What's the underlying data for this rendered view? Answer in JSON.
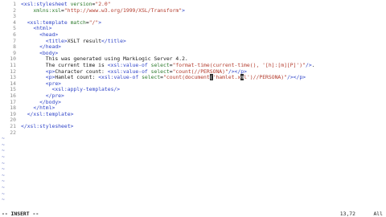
{
  "editor": {
    "lines": [
      {
        "n": "1",
        "segs": [
          [
            "t",
            "<xsl:stylesheet "
          ],
          [
            "a",
            "version"
          ],
          [
            "p",
            "="
          ],
          [
            "s",
            "\"2.0\""
          ]
        ]
      },
      {
        "n": "2",
        "segs": [
          [
            "p",
            "    "
          ],
          [
            "a",
            "xmlns:xsl"
          ],
          [
            "p",
            "="
          ],
          [
            "s",
            "\"http://www.w3.org/1999/XSL/Transform\""
          ],
          [
            "t",
            ">"
          ]
        ]
      },
      {
        "n": "3",
        "segs": []
      },
      {
        "n": "4",
        "segs": [
          [
            "p",
            "  "
          ],
          [
            "t",
            "<xsl:template "
          ],
          [
            "a",
            "match"
          ],
          [
            "p",
            "="
          ],
          [
            "s",
            "\"/\""
          ],
          [
            "t",
            ">"
          ]
        ]
      },
      {
        "n": "5",
        "segs": [
          [
            "p",
            "    "
          ],
          [
            "t",
            "<html>"
          ]
        ]
      },
      {
        "n": "6",
        "segs": [
          [
            "p",
            "      "
          ],
          [
            "t",
            "<head>"
          ]
        ]
      },
      {
        "n": "7",
        "segs": [
          [
            "p",
            "        "
          ],
          [
            "t",
            "<title>"
          ],
          [
            "p",
            "XSLT result"
          ],
          [
            "t",
            "</title>"
          ]
        ]
      },
      {
        "n": "8",
        "segs": [
          [
            "p",
            "      "
          ],
          [
            "t",
            "</head>"
          ]
        ]
      },
      {
        "n": "9",
        "segs": [
          [
            "p",
            "      "
          ],
          [
            "t",
            "<body>"
          ]
        ]
      },
      {
        "n": "10",
        "segs": [
          [
            "p",
            "        This was generated using MarkLogic Server 4.2."
          ]
        ]
      },
      {
        "n": "11",
        "segs": [
          [
            "p",
            "        The current time is "
          ],
          [
            "t",
            "<xsl:value-of "
          ],
          [
            "a",
            "select"
          ],
          [
            "p",
            "="
          ],
          [
            "s",
            "\"format-time(current-time(), '[h]:[m][P]')\""
          ],
          [
            "t",
            "/>"
          ],
          [
            "p",
            "."
          ]
        ]
      },
      {
        "n": "12",
        "segs": [
          [
            "p",
            "        "
          ],
          [
            "t",
            "<p>"
          ],
          [
            "p",
            "Character count: "
          ],
          [
            "t",
            "<xsl:value-of "
          ],
          [
            "a",
            "select"
          ],
          [
            "p",
            "="
          ],
          [
            "s",
            "\"count(//PERSONA)\""
          ],
          [
            "t",
            "/></p>"
          ]
        ]
      },
      {
        "n": "13",
        "segs": [
          [
            "p",
            "        "
          ],
          [
            "t",
            "<p>"
          ],
          [
            "p",
            "Hamlet count: "
          ],
          [
            "t",
            "<xsl:value-of "
          ],
          [
            "a",
            "select"
          ],
          [
            "p",
            "="
          ],
          [
            "s",
            "\"count(document"
          ],
          [
            "c",
            "("
          ],
          [
            "s",
            "'hamlet.x"
          ],
          [
            "c",
            "m"
          ],
          [
            "s",
            "l')//PERSONA)\""
          ],
          [
            "t",
            "/></p>"
          ]
        ]
      },
      {
        "n": "14",
        "segs": [
          [
            "p",
            "        "
          ],
          [
            "t",
            "<pre>"
          ]
        ]
      },
      {
        "n": "15",
        "segs": [
          [
            "p",
            "          "
          ],
          [
            "t",
            "<xsl:apply-templates/>"
          ]
        ]
      },
      {
        "n": "16",
        "segs": [
          [
            "p",
            "        "
          ],
          [
            "t",
            "</pre>"
          ]
        ]
      },
      {
        "n": "17",
        "segs": [
          [
            "p",
            "      "
          ],
          [
            "t",
            "</body>"
          ]
        ]
      },
      {
        "n": "18",
        "segs": [
          [
            "p",
            "    "
          ],
          [
            "t",
            "</html>"
          ]
        ]
      },
      {
        "n": "19",
        "segs": [
          [
            "p",
            "  "
          ],
          [
            "t",
            "</xsl:template>"
          ]
        ]
      },
      {
        "n": "20",
        "segs": []
      },
      {
        "n": "21",
        "segs": [
          [
            "t",
            "</xsl:stylesheet>"
          ]
        ]
      },
      {
        "n": "22",
        "segs": []
      }
    ],
    "tilde_marker": "~",
    "tilde_count": 11,
    "colors": {
      "tag": "#2f44c8",
      "attr": "#2d7a2d",
      "string": "#b33b2c",
      "line_number": "#8a8a8a",
      "tilde": "#5b6abf"
    }
  },
  "status": {
    "mode": "-- INSERT --",
    "position": "13,72",
    "percent": "All"
  }
}
